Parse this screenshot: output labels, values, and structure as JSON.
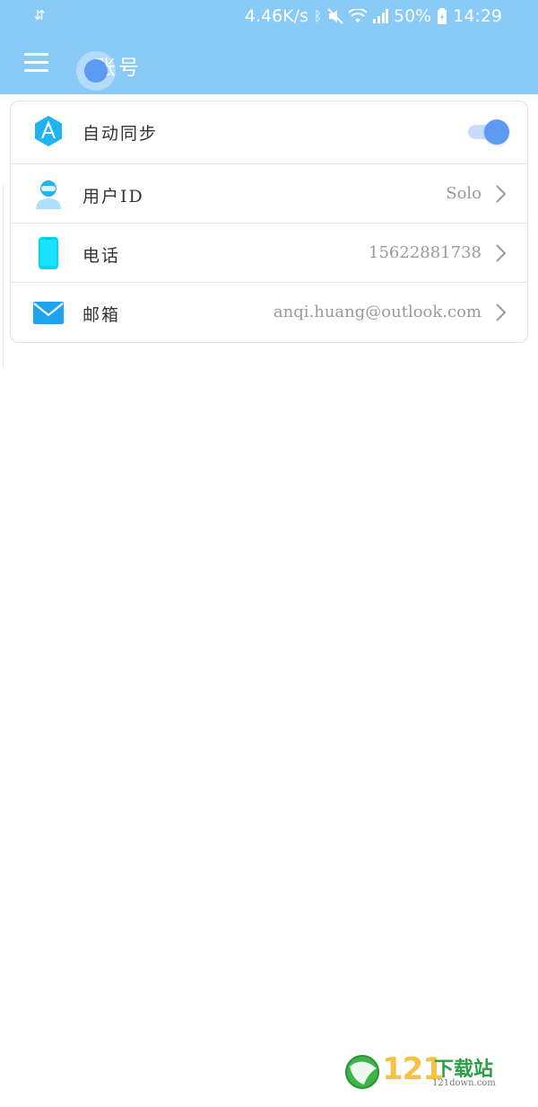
{
  "status_bar": {
    "left_icon": "data-transfer-icon",
    "network_speed": "4.46K/s",
    "icons": [
      "bluetooth-icon",
      "mute-icon",
      "wifi-icon",
      "signal-icon"
    ],
    "battery_percent": "50%",
    "time": "14:29"
  },
  "appbar": {
    "menu_icon": "hamburger-menu-icon",
    "title": "账号",
    "color": "#89caf7"
  },
  "settings": {
    "auto_sync": {
      "label": "自动同步",
      "icon": "app-logo-a-icon",
      "enabled": true
    },
    "user_id": {
      "label": "用户ID",
      "value": "Solo",
      "icon": "user-avatar-icon"
    },
    "phone": {
      "label": "电话",
      "value": "15622881738",
      "icon": "phone-icon"
    },
    "email": {
      "label": "邮箱",
      "value": "anqi.huang@outlook.com",
      "icon": "mail-icon"
    }
  },
  "watermark": {
    "number": "121",
    "text": "下载站",
    "url": "121down.com"
  },
  "colors": {
    "accent": "#5b9cf2",
    "icon_blue": "#1fb3f0"
  }
}
